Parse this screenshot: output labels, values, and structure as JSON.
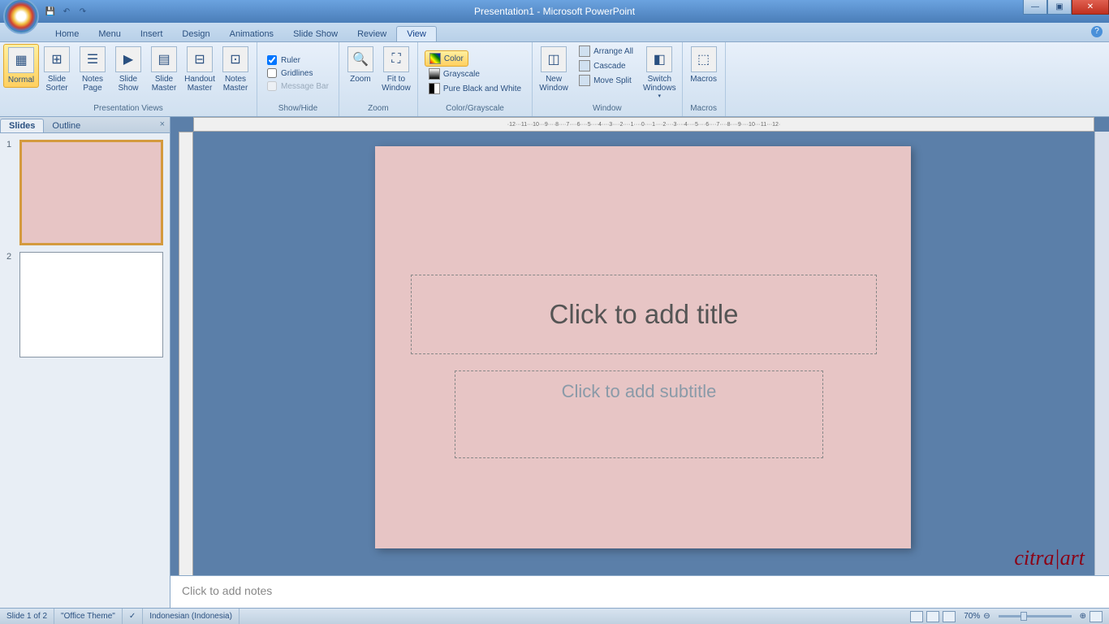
{
  "title": "Presentation1 - Microsoft PowerPoint",
  "tabs": [
    "Home",
    "Menu",
    "Insert",
    "Design",
    "Animations",
    "Slide Show",
    "Review",
    "View"
  ],
  "active_tab": "View",
  "ribbon": {
    "groups": {
      "pv": {
        "label": "Presentation Views",
        "normal": "Normal",
        "sorter": "Slide\nSorter",
        "page": "Notes\nPage",
        "show": "Slide\nShow",
        "smaster": "Slide\nMaster",
        "hmaster": "Handout\nMaster",
        "nmaster": "Notes\nMaster"
      },
      "sh": {
        "label": "Show/Hide",
        "ruler": "Ruler",
        "grid": "Gridlines",
        "msg": "Message Bar"
      },
      "zoom": {
        "label": "Zoom",
        "zoom": "Zoom",
        "fit": "Fit to\nWindow"
      },
      "cg": {
        "label": "Color/Grayscale",
        "color": "Color",
        "gray": "Grayscale",
        "bw": "Pure Black and White"
      },
      "win": {
        "label": "Window",
        "new": "New\nWindow",
        "arrange": "Arrange All",
        "cascade": "Cascade",
        "split": "Move Split",
        "switch": "Switch\nWindows"
      },
      "mac": {
        "label": "Macros",
        "macros": "Macros"
      }
    }
  },
  "panel": {
    "tab1": "Slides",
    "tab2": "Outline"
  },
  "thumbs": [
    {
      "n": "1"
    },
    {
      "n": "2"
    }
  ],
  "slide": {
    "title": "Click to add title",
    "subtitle": "Click to add subtitle"
  },
  "notes": "Click to add notes",
  "watermark": "citra|art",
  "status": {
    "slide": "Slide 1 of 2",
    "theme": "\"Office Theme\"",
    "lang": "Indonesian (Indonesia)",
    "zoom": "70%"
  },
  "ruler_text": "·12···11···10···9····8····7····6····5····4····3····2····1····0····1····2····3····4····5····6····7····8····9····10···11···12·"
}
